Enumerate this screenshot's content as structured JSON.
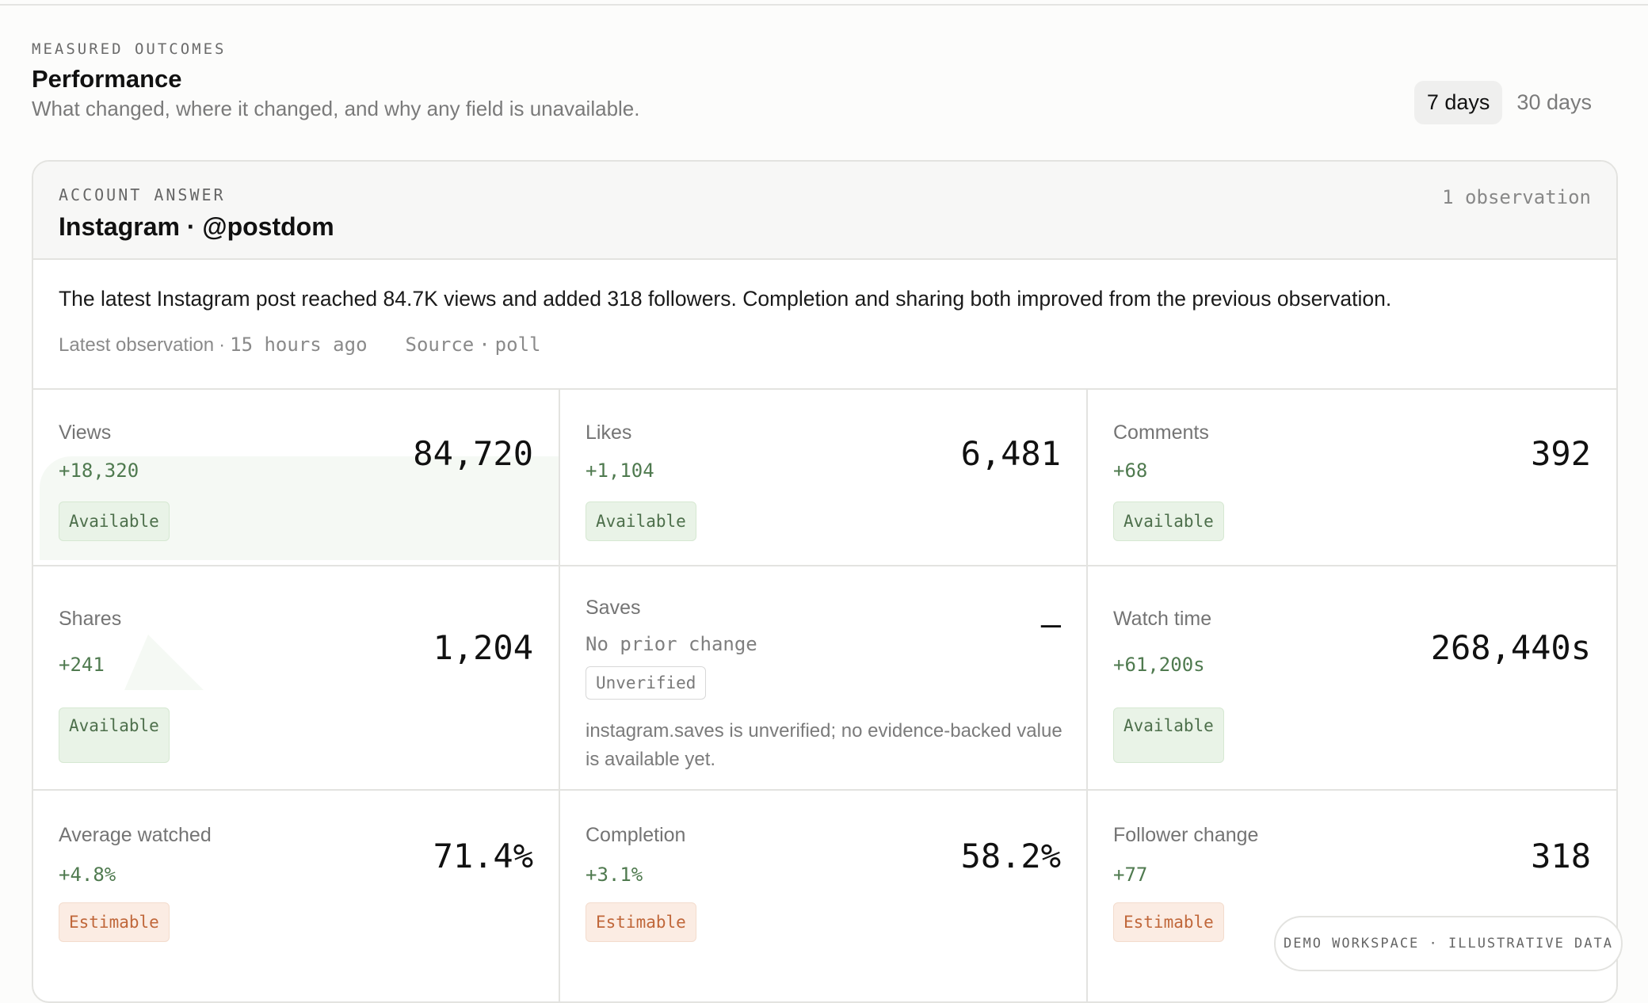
{
  "header": {
    "eyebrow": "MEASURED OUTCOMES",
    "title": "Performance",
    "subtitle": "What changed, where it changed, and why any field is unavailable.",
    "ranges": [
      {
        "label": "7 days",
        "active": true
      },
      {
        "label": "30 days",
        "active": false
      }
    ]
  },
  "account": {
    "eyebrow": "ACCOUNT ANSWER",
    "title": "Instagram · @postdom",
    "observation_count": "1 observation",
    "summary": "The latest Instagram post reached 84.7K views and added 318 followers. Completion and sharing both improved from the previous observation.",
    "latest_label": "Latest observation",
    "latest_value": "15 hours ago",
    "source_label": "Source",
    "source_value": "poll"
  },
  "metrics": [
    {
      "label": "Views",
      "delta": "+18,320",
      "value": "84,720",
      "status": "Available"
    },
    {
      "label": "Likes",
      "delta": "+1,104",
      "value": "6,481",
      "status": "Available"
    },
    {
      "label": "Comments",
      "delta": "+68",
      "value": "392",
      "status": "Available"
    },
    {
      "label": "Shares",
      "delta": "+241",
      "value": "1,204",
      "status": "Available"
    },
    {
      "label": "Saves",
      "delta": "No prior change",
      "value": "—",
      "status": "Unverified",
      "note": "instagram.saves is unverified; no evidence-backed value is available yet."
    },
    {
      "label": "Watch time",
      "delta": "+61,200s",
      "value": "268,440s",
      "status": "Available"
    },
    {
      "label": "Average watched",
      "delta": "+4.8%",
      "value": "71.4%",
      "status": "Estimable"
    },
    {
      "label": "Completion",
      "delta": "+3.1%",
      "value": "58.2%",
      "status": "Estimable"
    },
    {
      "label": "Follower change",
      "delta": "+77",
      "value": "318",
      "status": "Estimable"
    }
  ],
  "footer": {
    "demo_label": "DEMO WORKSPACE · ILLUSTRATIVE DATA"
  },
  "colors": {
    "available_bg": "#e9f3e7",
    "available_text": "#4d6f4b",
    "estimable_bg": "#fbece3",
    "estimable_text": "#c0673a",
    "delta_green": "#4f7a4f"
  }
}
